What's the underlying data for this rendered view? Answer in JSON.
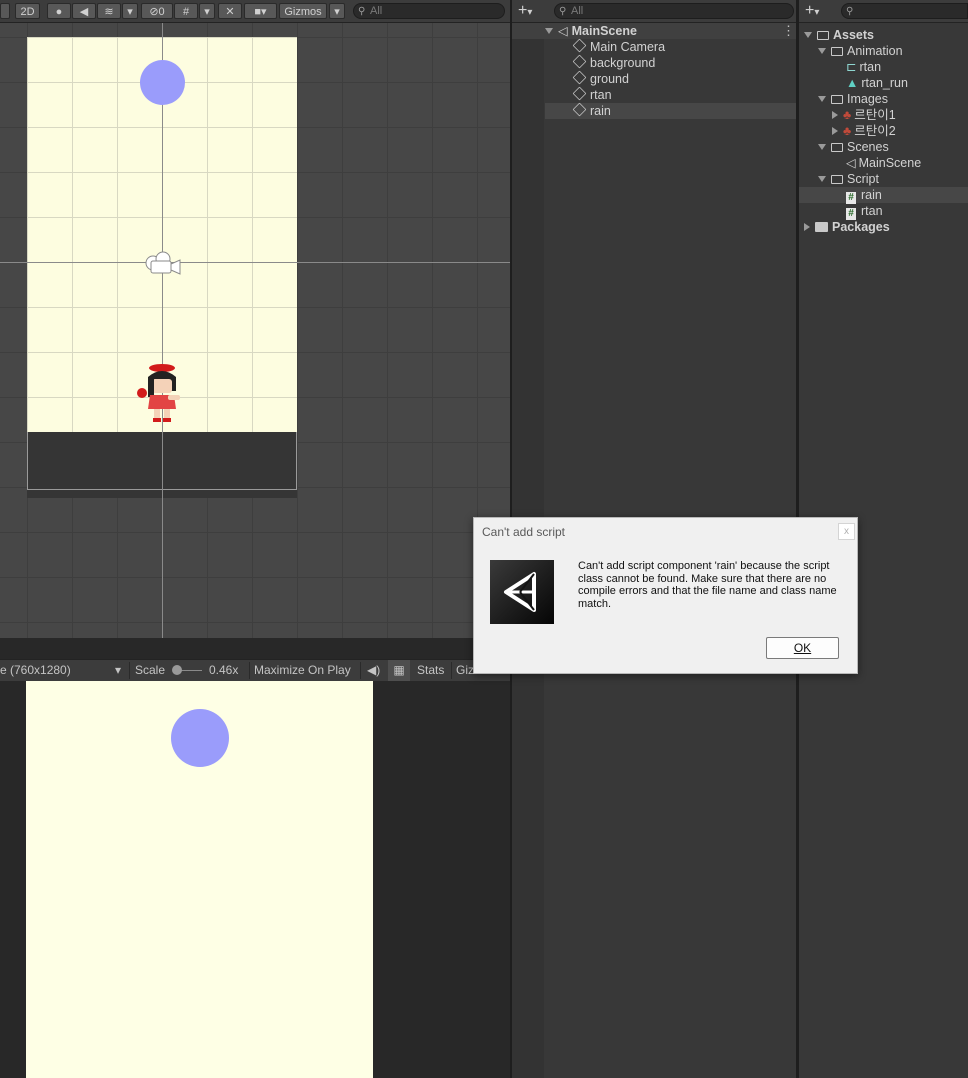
{
  "scene_toolbar": {
    "mode_2d": "2D",
    "hidden_count": "0",
    "gizmos": "Gizmos",
    "search_placeholder": "All"
  },
  "game_toolbar": {
    "resolution": "e (760x1280)",
    "scale_label": "Scale",
    "scale_value": "0.46x",
    "maximize": "Maximize On Play",
    "stats": "Stats",
    "gizmos": "Gizmos"
  },
  "hierarchy": {
    "search_placeholder": "All",
    "scene": "MainScene",
    "items": [
      "Main Camera",
      "background",
      "ground",
      "rtan",
      "rain"
    ]
  },
  "project": {
    "root": "Assets",
    "animation_folder": "Animation",
    "animation_items": [
      "rtan",
      "rtan_run"
    ],
    "images_folder": "Images",
    "image_items": [
      "르탄이1",
      "르탄이2"
    ],
    "scenes_folder": "Scenes",
    "scene_items": [
      "MainScene"
    ],
    "script_folder": "Script",
    "script_items": [
      "rain",
      "rtan"
    ],
    "packages": "Packages"
  },
  "dialog": {
    "title": "Can't add script",
    "message": "Can't add script component 'rain' because the script class cannot be found. Make sure that there are no compile errors and that the file name and class name match.",
    "ok": "OK",
    "close": "x"
  },
  "colors": {
    "background_yellow": "#fdfde0",
    "circle": "#9a9cfb",
    "selection": "#474747"
  }
}
